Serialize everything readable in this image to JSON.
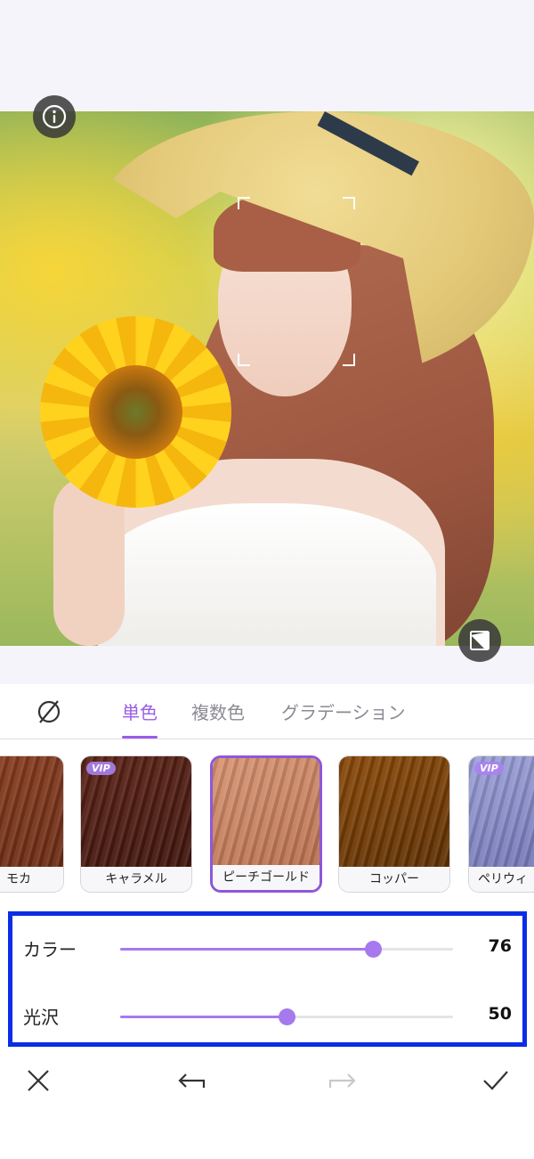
{
  "tabs": {
    "items": [
      {
        "label": "単色",
        "active": true
      },
      {
        "label": "複数色",
        "active": false
      },
      {
        "label": "グラデーション",
        "active": false
      }
    ],
    "none_icon": "no-color-icon"
  },
  "swatches": [
    {
      "name": "モカ",
      "vip": false,
      "selected": false,
      "color_top": "#8b3f22",
      "color_bottom": "#6b2c15"
    },
    {
      "name": "キャラメル",
      "vip": true,
      "selected": false,
      "color_top": "#5c2418",
      "color_bottom": "#3f150d"
    },
    {
      "name": "ピーチゴールド",
      "vip": false,
      "selected": true,
      "color_top": "#d99674",
      "color_bottom": "#b8704e"
    },
    {
      "name": "コッパー",
      "vip": false,
      "selected": false,
      "color_top": "#8a4a0a",
      "color_bottom": "#5e2f03"
    },
    {
      "name": "ペリウィ",
      "vip": true,
      "selected": false,
      "color_top": "#9ea2d8",
      "color_bottom": "#6f73b3"
    }
  ],
  "vip_label": "VIP",
  "sliders": [
    {
      "label": "カラー",
      "value": "76",
      "fraction": 0.76
    },
    {
      "label": "光沢",
      "value": "50",
      "fraction": 0.5
    }
  ],
  "colors": {
    "accent": "#9b5de5",
    "highlight_border": "#0a2de6"
  },
  "icons": {
    "info": "info-icon",
    "compare": "compare-icon",
    "cancel": "close-icon",
    "undo": "undo-icon",
    "redo": "redo-icon",
    "confirm": "check-icon"
  }
}
